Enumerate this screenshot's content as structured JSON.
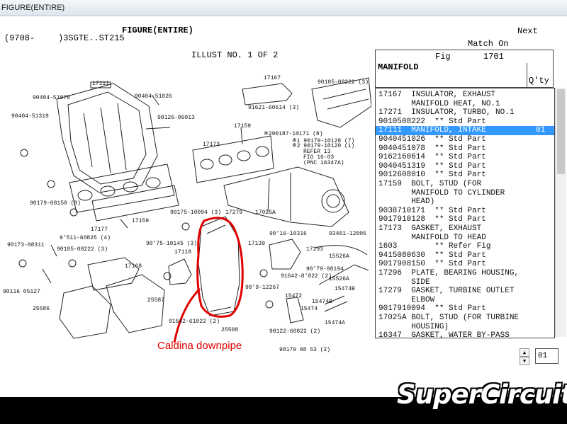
{
  "window": {
    "title": "FIGURE(ENTIRE)"
  },
  "header": {
    "figure_title": "FIGURE(ENTIRE)",
    "model_code_open": "(9708-",
    "model_code": ")3SGTE..ST215",
    "next_label": "Next",
    "match_on_label": "Match On",
    "illust_label": "ILLUST NO. 1 OF 2"
  },
  "fig_panel": {
    "fig_label": "Fig",
    "fig_number": "1701",
    "name": "MANIFOLD",
    "qty_label": "Q'ty"
  },
  "parts_list": [
    {
      "text": "17167  INSULATOR, EXHAUST",
      "selected": false
    },
    {
      "text": "       MANIFOLD HEAT, NO.1",
      "selected": false
    },
    {
      "text": "17271  INSULATOR, TURBO, NO.1",
      "selected": false
    },
    {
      "text": "9010508222  ** Std Part",
      "selected": false
    },
    {
      "text": "17111  MANIFOLD, INTAKE",
      "qty": "01",
      "selected": true
    },
    {
      "text": "9040451026  ** Std Part",
      "selected": false
    },
    {
      "text": "9040451078  ** Std Part",
      "selected": false
    },
    {
      "text": "9162160614  ** Std Part",
      "selected": false
    },
    {
      "text": "9040451319  ** Std Part",
      "selected": false
    },
    {
      "text": "9012608010  ** Std Part",
      "selected": false
    },
    {
      "text": "17159  BOLT, STUD (FOR",
      "selected": false
    },
    {
      "text": "       MANIFOLD TO CYLINDER",
      "selected": false
    },
    {
      "text": "       HEAD)",
      "selected": false
    },
    {
      "text": "9038710171  ** Std Part",
      "selected": false
    },
    {
      "text": "9017910128  ** Std Part",
      "selected": false
    },
    {
      "text": "17173  GASKET, EXHAUST",
      "selected": false
    },
    {
      "text": "       MANIFOLD TO HEAD",
      "selected": false
    },
    {
      "text": "1603        ** Refer Fig",
      "selected": false
    },
    {
      "text": "9415080630  ** Std Part",
      "selected": false
    },
    {
      "text": "9017908150  ** Std Part",
      "selected": false
    },
    {
      "text": "17296  PLATE, BEARING HOUSING,",
      "selected": false
    },
    {
      "text": "       SIDE",
      "selected": false
    },
    {
      "text": "17279  GASKET, TURBINE OUTLET",
      "selected": false
    },
    {
      "text": "       ELBOW",
      "selected": false
    },
    {
      "text": "9017910094  ** Std Part",
      "selected": false
    },
    {
      "text": "17025A BOLT, STUD (FOR TURBINE",
      "selected": false
    },
    {
      "text": "       HOUSING)",
      "selected": false
    },
    {
      "text": "16347  GASKET, WATER BY-PASS",
      "selected": false
    }
  ],
  "qty_input": {
    "value": "01"
  },
  "diagram_labels": [
    "17167",
    "90105-08222 (3)",
    "90404-51078",
    "17111",
    "90404-51026",
    "91621-60614 (3)",
    "90404-51319",
    "90126-06013",
    "17159",
    "※290187-10171 (8)",
    "※1 90179-10128 (7)",
    "※2 90179-10120 (1)",
    "17173",
    "REFER 13",
    "FIG 16-03",
    "(PNC 16347A)",
    "90179-08150 (8)",
    "17177",
    "17159",
    "17025A",
    "90175-10094 (3)",
    "17279",
    "90'16-10316",
    "93401-12005",
    "9'511-60825 (4)",
    "90173-08311",
    "90105-08222 (3)",
    "90'75-10145 (3)",
    "17118",
    "17139",
    "17293",
    "15526A",
    "17168",
    "90'79-08194",
    "91642-8'022 (2)",
    "15526A",
    "90116 05127",
    "25587",
    "90'9-12267",
    "15474B",
    "25586",
    "15472",
    "15474B",
    "15474",
    "15474A",
    "91642-61022 (2)",
    "25508",
    "90122-60822 (2)",
    "90179 08 53 (2)"
  ],
  "annotation": {
    "caption": "Caldina downpipe",
    "color": "#e00000"
  },
  "brand": {
    "logo_text": "SuperCircuit"
  },
  "colors": {
    "selection": "#3399ff",
    "annotation": "#e00000",
    "band": "#000000"
  }
}
